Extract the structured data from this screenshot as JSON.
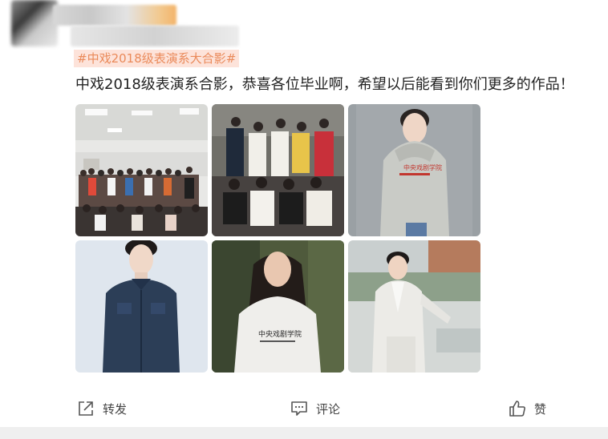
{
  "post": {
    "topic": "#中戏2018级表演系大合影#",
    "text": "中戏2018级表演系合影，恭喜各位毕业啊，希望以后能看到你们更多的作品！",
    "photos": [
      {
        "kind": "group-photo-classroom"
      },
      {
        "kind": "group-photo-casual"
      },
      {
        "kind": "portrait-grey-hoodie",
        "shirt_text": "中央戏剧学院"
      },
      {
        "kind": "portrait-denim-shirt"
      },
      {
        "kind": "portrait-white-tshirt",
        "shirt_text": "中央戏剧学院"
      },
      {
        "kind": "portrait-white-suit"
      }
    ]
  },
  "actions": {
    "repost": {
      "label": "转发",
      "icon": "share-icon"
    },
    "comment": {
      "label": "评论",
      "icon": "comment-icon"
    },
    "like": {
      "label": "赞",
      "icon": "thumbs-up-icon"
    }
  },
  "colors": {
    "topic_bg": "#fde3da",
    "topic_text": "#ea8a5a",
    "body_text": "#222222"
  }
}
